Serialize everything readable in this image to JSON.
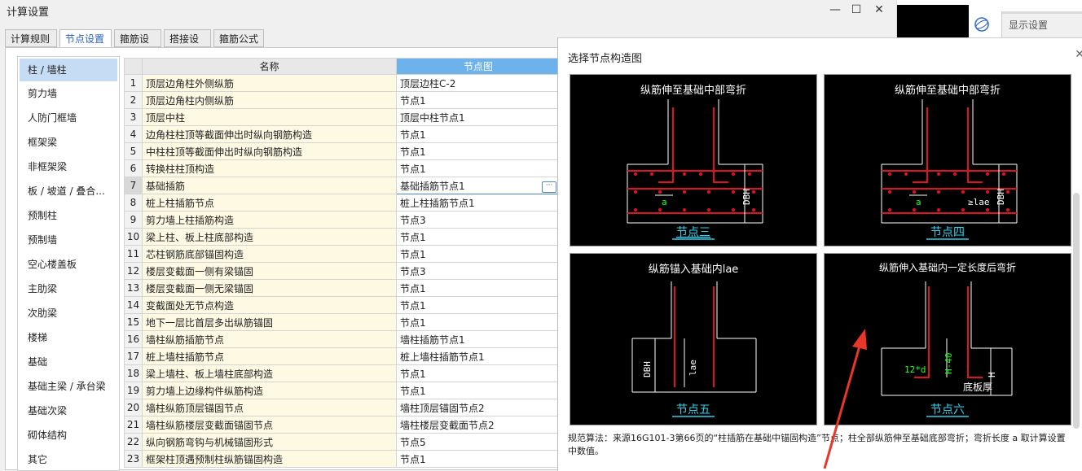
{
  "window": {
    "title": "计算设置"
  },
  "tabs": [
    "计算规则",
    "节点设置",
    "箍筋设置",
    "搭接设置",
    "箍筋公式"
  ],
  "left_items": [
    "柱 / 墙柱",
    "剪力墙",
    "人防门框墙",
    "框架梁",
    "非框架梁",
    "板 / 坡道 / 叠合...",
    "预制柱",
    "预制墙",
    "空心楼盖板",
    "主肋梁",
    "次肋梁",
    "楼梯",
    "基础",
    "基础主梁 / 承台梁",
    "基础次梁",
    "砌体结构",
    "其它"
  ],
  "grid": {
    "headers": {
      "name": "名称",
      "node": "节点图"
    },
    "rows": [
      {
        "idx": "1",
        "name": "顶层边角柱外侧纵筋",
        "value": "顶层边柱C-2"
      },
      {
        "idx": "2",
        "name": "顶层边角柱内侧纵筋",
        "value": "节点1"
      },
      {
        "idx": "3",
        "name": "顶层中柱",
        "value": "顶层中柱节点1"
      },
      {
        "idx": "4",
        "name": "边角柱柱顶等截面伸出时纵向钢筋构造",
        "value": "节点1"
      },
      {
        "idx": "5",
        "name": "中柱柱顶等截面伸出时纵向钢筋构造",
        "value": "节点1"
      },
      {
        "idx": "6",
        "name": "转换柱柱顶构造",
        "value": "节点1"
      },
      {
        "idx": "7",
        "name": "基础插筋",
        "value": "基础插筋节点1"
      },
      {
        "idx": "8",
        "name": "桩上柱插筋节点",
        "value": "桩上柱插筋节点1"
      },
      {
        "idx": "9",
        "name": "剪力墙上柱插筋构造",
        "value": "节点3"
      },
      {
        "idx": "10",
        "name": "梁上柱、板上柱底部构造",
        "value": "节点1"
      },
      {
        "idx": "11",
        "name": "芯柱钢筋底部锚固构造",
        "value": "节点1"
      },
      {
        "idx": "12",
        "name": "楼层变截面一侧有梁锚固",
        "value": "节点3"
      },
      {
        "idx": "13",
        "name": "楼层变截面一侧无梁锚固",
        "value": "节点1"
      },
      {
        "idx": "14",
        "name": "变截面处无节点构造",
        "value": "节点1"
      },
      {
        "idx": "15",
        "name": "地下一层比首层多出纵筋锚固",
        "value": "节点1"
      },
      {
        "idx": "16",
        "name": "墙柱纵筋插筋节点",
        "value": "墙柱插筋节点1"
      },
      {
        "idx": "17",
        "name": "桩上墙柱插筋节点",
        "value": "桩上墙柱插筋节点1"
      },
      {
        "idx": "18",
        "name": "梁上墙柱、板上墙柱底部构造",
        "value": "节点1"
      },
      {
        "idx": "19",
        "name": "剪力墙上边缘构件纵筋构造",
        "value": "节点1"
      },
      {
        "idx": "20",
        "name": "墙柱纵筋顶层锚固节点",
        "value": "墙柱顶层锚固节点2"
      },
      {
        "idx": "21",
        "name": "墙柱纵筋楼层变截面锚固节点",
        "value": "墙柱楼层变截面节点2"
      },
      {
        "idx": "22",
        "name": "纵向钢筋弯钩与机械锚固形式",
        "value": "节点5"
      },
      {
        "idx": "23",
        "name": "框架柱顶遇预制柱纵筋锚固构造",
        "value": "节点1"
      }
    ]
  },
  "dialog": {
    "title": "选择节点构造图",
    "panels": [
      {
        "top": "纵筋伸至基础中部弯折",
        "caption": "节点三",
        "dim_a": "a",
        "dim_h": "DBH"
      },
      {
        "top": "纵筋伸至基础中部弯折",
        "caption": "节点四",
        "dim_a": "a",
        "dim_h": "DBH",
        "dim_lae": "≥lae"
      },
      {
        "top": "纵筋锚入基础内lae",
        "caption": "节点五",
        "dim_h": "DBH",
        "dim_lae": "lae"
      },
      {
        "top": "纵筋伸入基础内一定长度后弯折",
        "caption": "节点六",
        "dim_12d": "12*d",
        "dim_h40": "H-40",
        "dim_h": "H",
        "bottom_label": "底板厚"
      }
    ],
    "description": "规范算法：来源16G101-3第66页的“柱插筋在基础中锚固构造”节点；柱全部纵筋伸至基础底部弯折；弯折长度 a 取计算设置中数值。"
  },
  "side": {
    "display_settings": "显示设置"
  },
  "colors": {
    "accent": "#2a62c0",
    "header_blue": "#6eb2ec",
    "rebar_red": "#e0141e",
    "annotation_red": "#e8372a"
  }
}
